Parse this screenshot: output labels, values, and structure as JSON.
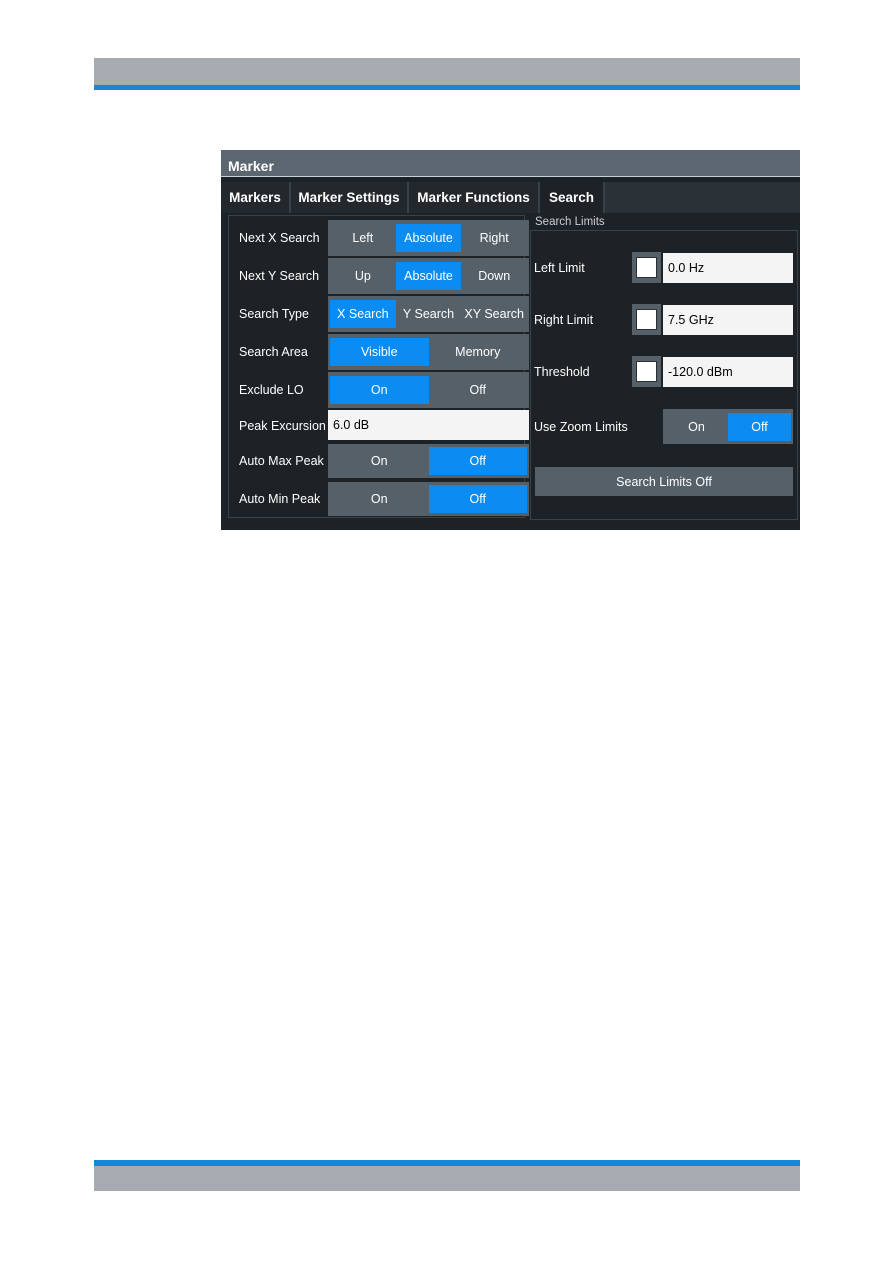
{
  "dialog": {
    "title": "Marker",
    "tabs": [
      {
        "label": "Markers",
        "active": false
      },
      {
        "label": "Marker Settings",
        "active": false
      },
      {
        "label": "Marker Functions",
        "active": false
      },
      {
        "label": "Search",
        "active": true
      }
    ],
    "left": {
      "next_x": {
        "label": "Next X Search",
        "options": [
          "Left",
          "Absolute",
          "Right"
        ],
        "selected": "Absolute"
      },
      "next_y": {
        "label": "Next Y Search",
        "options": [
          "Up",
          "Absolute",
          "Down"
        ],
        "selected": "Absolute"
      },
      "search_type": {
        "label": "Search Type",
        "options": [
          "X Search",
          "Y Search",
          "XY Search"
        ],
        "selected": "X Search"
      },
      "search_area": {
        "label": "Search Area",
        "options": [
          "Visible",
          "Memory"
        ],
        "selected": "Visible"
      },
      "exclude_lo": {
        "label": "Exclude LO",
        "options": [
          "On",
          "Off"
        ],
        "selected": "On"
      },
      "peak_excursion": {
        "label": "Peak Excursion",
        "value": "6.0 dB"
      },
      "auto_max_peak": {
        "label": "Auto Max Peak",
        "options": [
          "On",
          "Off"
        ],
        "selected": "Off"
      },
      "auto_min_peak": {
        "label": "Auto Min Peak",
        "options": [
          "On",
          "Off"
        ],
        "selected": "Off"
      }
    },
    "search_limits": {
      "group_label": "Search Limits",
      "left_limit": {
        "label": "Left Limit",
        "value": "0.0 Hz",
        "checked": false
      },
      "right_limit": {
        "label": "Right Limit",
        "value": "7.5 GHz",
        "checked": false
      },
      "threshold": {
        "label": "Threshold",
        "value": "-120.0 dBm",
        "checked": false
      },
      "use_zoom_limits": {
        "label": "Use Zoom Limits",
        "options": [
          "On",
          "Off"
        ],
        "selected": "Off"
      },
      "off_button": "Search Limits Off"
    }
  },
  "colors": {
    "accent": "#0a8cf2",
    "header_stripe": "#0f8ad3",
    "header_gray": "#a5abb0"
  }
}
